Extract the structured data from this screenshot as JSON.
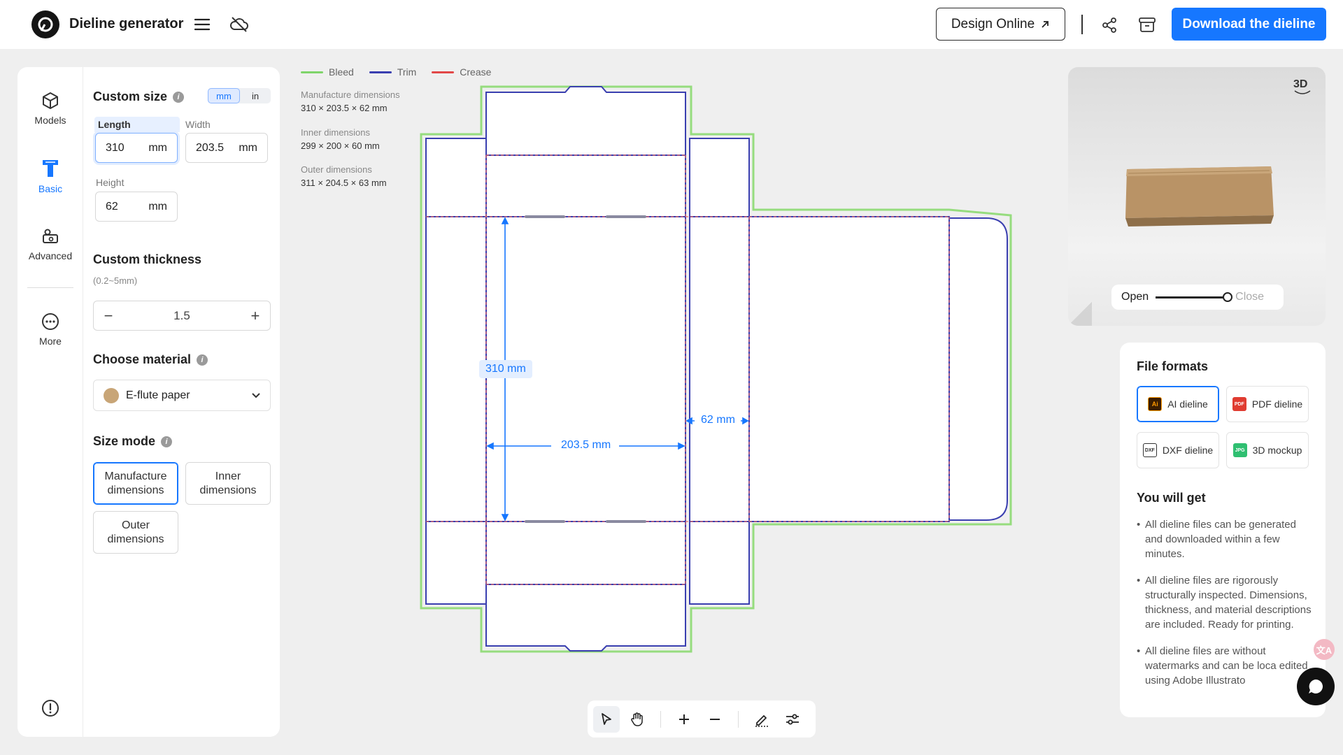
{
  "header": {
    "app_title": "Dieline generator",
    "design_online_label": "Design Online",
    "download_label": "Download the dieline"
  },
  "nav": {
    "items": [
      {
        "label": "Models",
        "icon": "cube-icon"
      },
      {
        "label": "Basic",
        "icon": "basic-t-icon"
      },
      {
        "label": "Advanced",
        "icon": "advanced-icon"
      },
      {
        "label": "More",
        "icon": "more-icon"
      }
    ],
    "active": "Basic"
  },
  "custom_size": {
    "title": "Custom size",
    "units": [
      "mm",
      "in"
    ],
    "active_unit": "mm",
    "length_label": "Length",
    "length_value": "310",
    "width_label": "Width",
    "width_value": "203.5",
    "height_label": "Height",
    "height_value": "62",
    "unit": "mm"
  },
  "thickness": {
    "title": "Custom thickness",
    "range": "(0.2~5mm)",
    "value": "1.5",
    "minus": "−",
    "plus": "+"
  },
  "material": {
    "title": "Choose material",
    "selected": "E-flute paper",
    "swatch_color": "#c8a577"
  },
  "size_mode": {
    "title": "Size mode",
    "options": [
      "Manufacture dimensions",
      "Inner dimensions",
      "Outer dimensions"
    ],
    "active": "Manufacture dimensions"
  },
  "legend": {
    "bleed": "Bleed",
    "trim": "Trim",
    "crease": "Crease",
    "bleed_color": "#7fd46a",
    "trim_color": "#3a3fb0",
    "crease_color": "#e24848"
  },
  "dimensions": {
    "manufacture_label": "Manufacture dimensions",
    "manufacture_value": "310 × 203.5 × 62 mm",
    "inner_label": "Inner dimensions",
    "inner_value": "299 × 200 × 60 mm",
    "outer_label": "Outer dimensions",
    "outer_value": "311 × 204.5 × 63 mm"
  },
  "dieline_labels": {
    "length": "310 mm",
    "width": "203.5 mm",
    "height": "62 mm"
  },
  "preview": {
    "badge": "3D",
    "open_label": "Open",
    "close_label": "Close",
    "fold_level": 1.0
  },
  "file_formats": {
    "title": "File formats",
    "options": [
      {
        "label": "AI dieline",
        "icon": "ai-file-icon",
        "badge": "Ai",
        "color": "#ff7a00"
      },
      {
        "label": "PDF dieline",
        "icon": "pdf-file-icon",
        "badge": "PDF",
        "color": "#e03c31"
      },
      {
        "label": "DXF dieline",
        "icon": "dxf-file-icon",
        "badge": "DXF",
        "color": "#333333"
      },
      {
        "label": "3D mockup",
        "icon": "jpg-file-icon",
        "badge": "JPG",
        "color": "#2fbf71"
      }
    ],
    "active": "AI dieline",
    "you_will_get_title": "You will get",
    "benefits": [
      "All dieline files can be generated and downloaded within a few minutes.",
      "All dieline files are rigorously structurally inspected. Dimensions, thickness, and material descriptions are included. Ready for printing.",
      "All dieline files are without watermarks and can be loca edited using Adobe Illustrato"
    ]
  },
  "colors": {
    "accent": "#1677ff",
    "canvas_bg": "#efefef"
  }
}
